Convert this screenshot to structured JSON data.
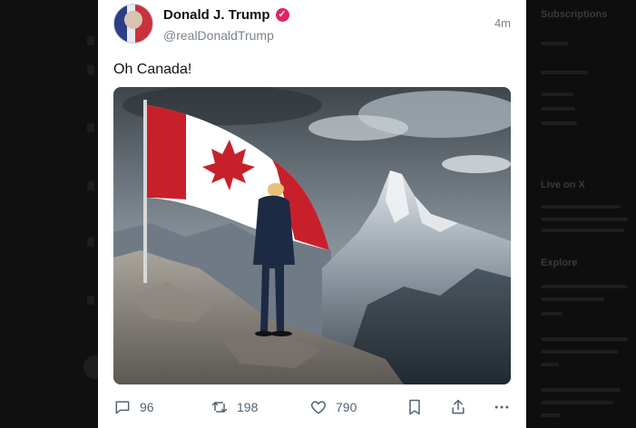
{
  "post": {
    "display_name": "Donald J. Trump",
    "handle": "@realDonaldTrump",
    "timestamp": "4m",
    "text": "Oh Canada!",
    "verified_icon": "verified-badge-icon",
    "actions": {
      "replies": "96",
      "reposts": "198",
      "likes": "790"
    }
  },
  "sidebar": {
    "headings": [
      "Subscriptions",
      "Live on X",
      "Explore"
    ]
  },
  "colors": {
    "card_bg": "#ffffff",
    "text_primary": "#0f1419",
    "text_secondary": "#536471",
    "verified": "#e0245e",
    "flag_red": "#c8202a",
    "page_bg": "#0c0c0c"
  }
}
